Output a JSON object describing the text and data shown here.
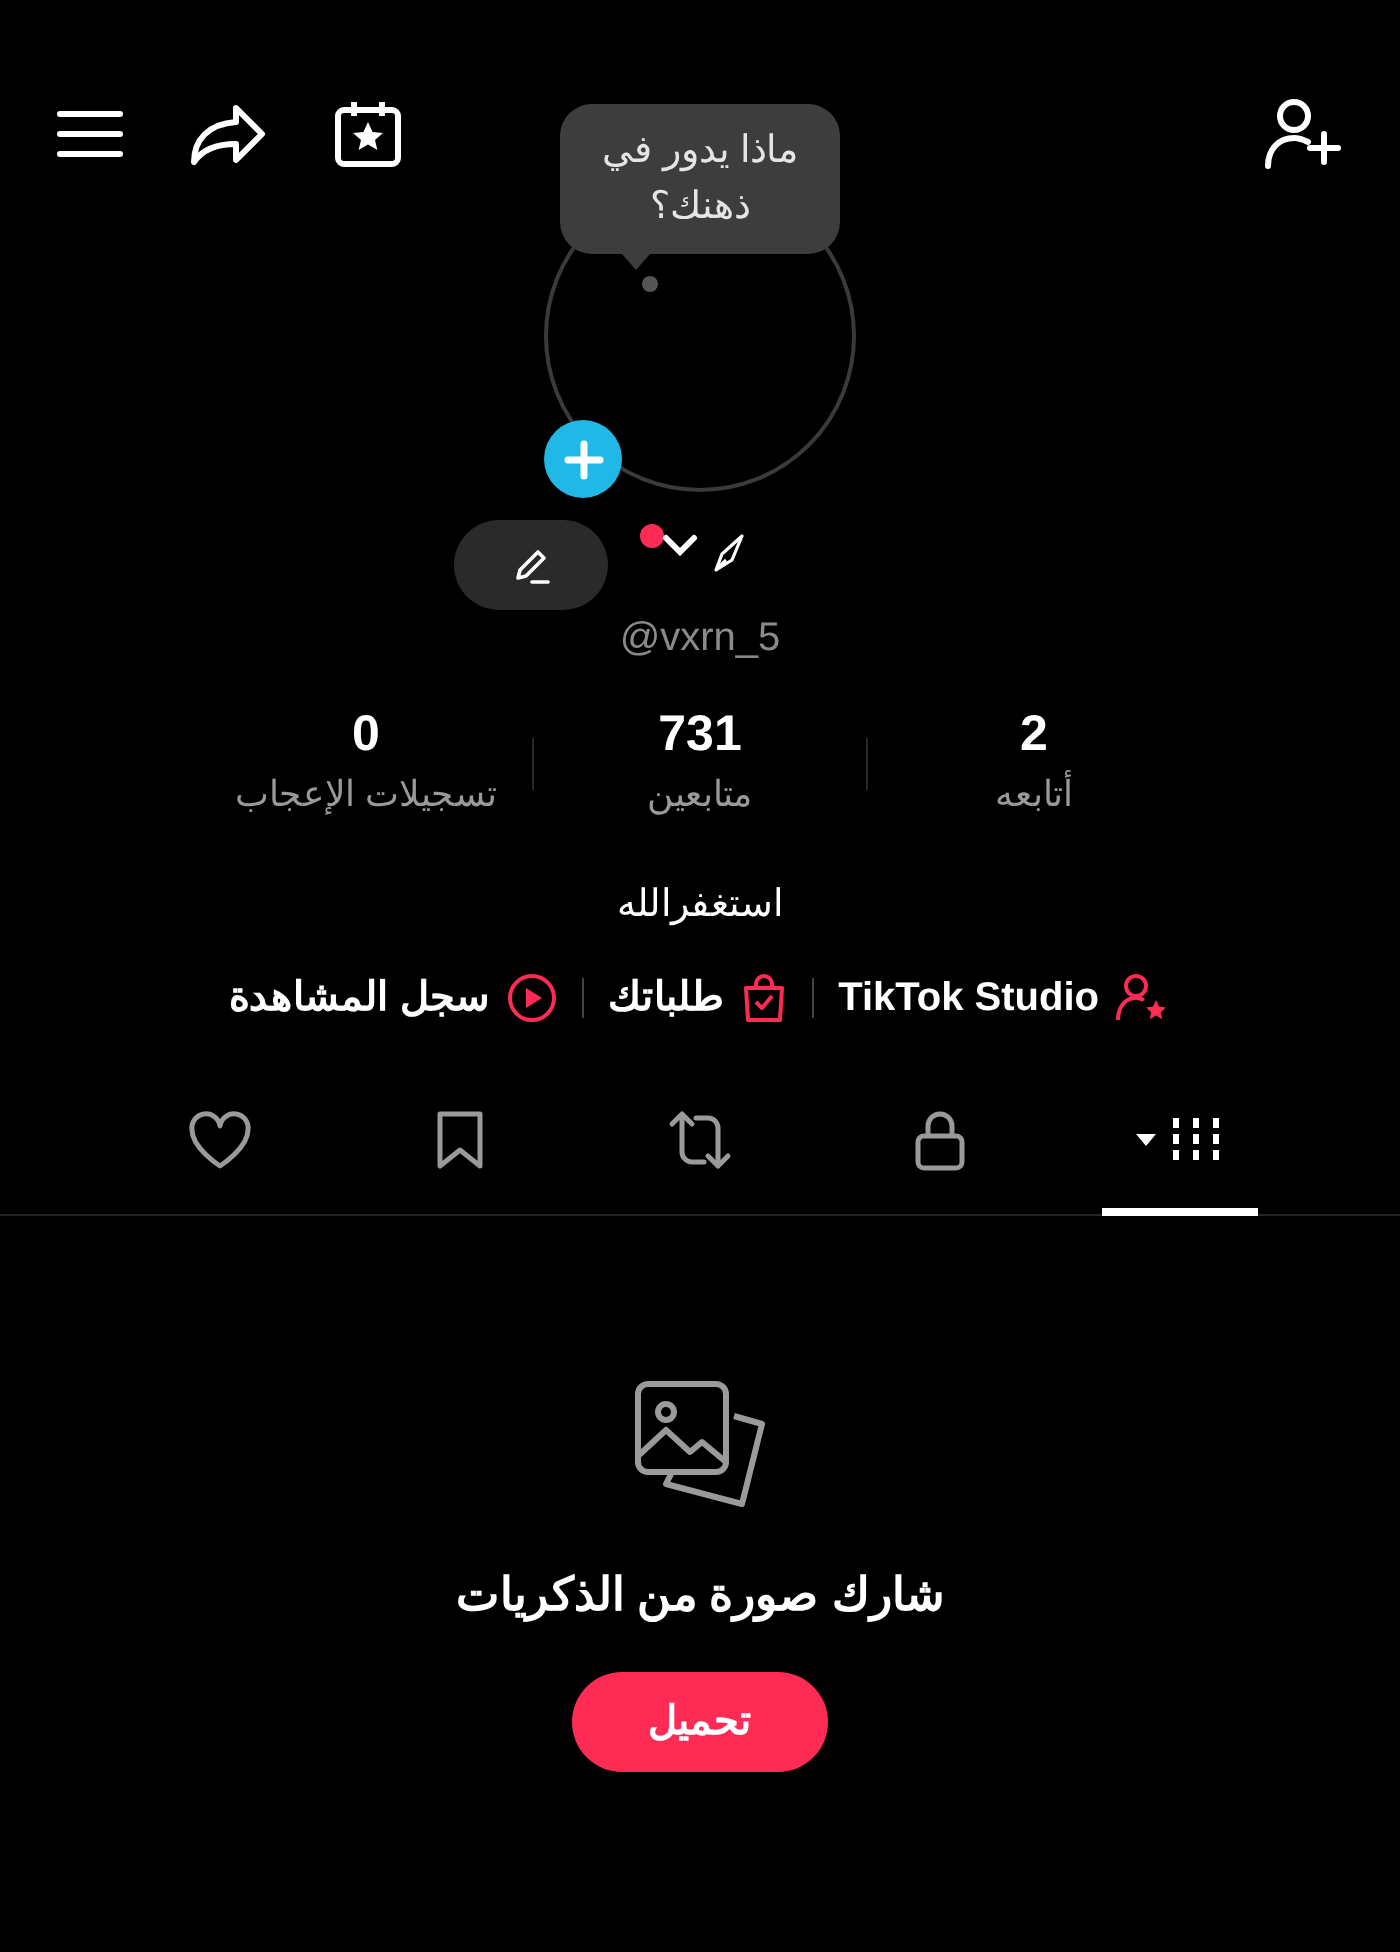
{
  "top_bar": {
    "icons": [
      {
        "kind": "menu"
      },
      {
        "kind": "share"
      },
      {
        "kind": "calendar"
      },
      {
        "kind": "add-user"
      }
    ]
  },
  "avatar": {
    "note_bubble": "ماذا يدور في ذهنك؟",
    "username": "@vxrn_5",
    "has_notification": true
  },
  "stats": [
    {
      "value": "2",
      "label": "أتابعه"
    },
    {
      "value": "731",
      "label": "متابعين"
    },
    {
      "value": "0",
      "label": "تسجيلات الإعجاب"
    }
  ],
  "bio": "استغفرالله",
  "links": [
    {
      "kind": "studio",
      "label": "TikTok Studio"
    },
    {
      "kind": "orders",
      "label": "طلباتك"
    },
    {
      "kind": "history",
      "label": "سجل المشاهدة"
    }
  ],
  "tabs": [
    {
      "kind": "grid",
      "selected": true
    },
    {
      "kind": "lock",
      "selected": false
    },
    {
      "kind": "repost",
      "selected": false
    },
    {
      "kind": "bookmark",
      "selected": false
    },
    {
      "kind": "heart",
      "selected": false
    }
  ],
  "empty_state": {
    "title": "شارك صورة من الذكريات",
    "button": "تحميل"
  }
}
